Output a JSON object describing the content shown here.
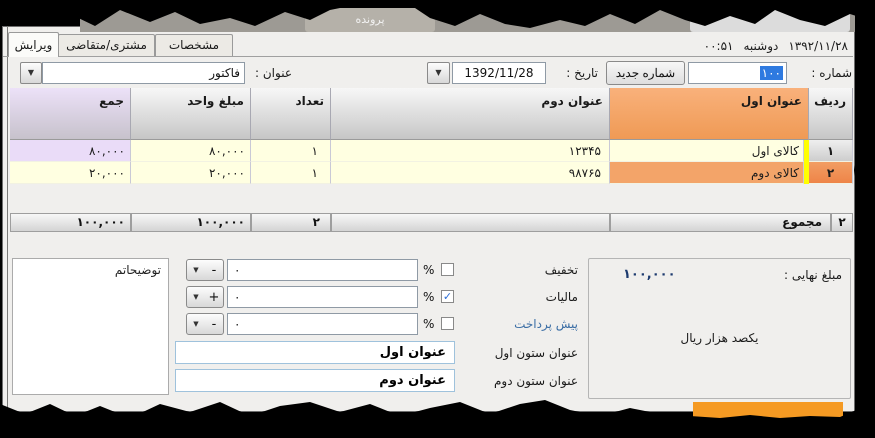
{
  "symbols": {
    "dropdown": "▼",
    "percent": "%"
  },
  "top_strip": {
    "file_tab": "پرونده"
  },
  "tabs": [
    {
      "label": "مشخصات"
    },
    {
      "label": "مشتری/متقاضی"
    },
    {
      "label": "ویرایش"
    }
  ],
  "timestamp": {
    "time": "۰۰:۵۱",
    "day": "دوشنبه",
    "date": "۱۳۹۲/۱۱/۲۸"
  },
  "fields": {
    "number_label": "شماره :",
    "number_value": "۱۰۰",
    "new_number_button": "شماره جدید",
    "date_label": "تاریخ :",
    "date_value": "1392/11/28",
    "title_label": "عنوان :",
    "title_value": "فاکتور"
  },
  "table": {
    "headers": {
      "row": "ردیف",
      "first_title": "عنوان اول",
      "second_title": "عنوان دوم",
      "count": "تعداد",
      "unit_price": "مبلغ واحد",
      "total": "جمع"
    },
    "rows": [
      {
        "row": "۱",
        "first_title": "کالای اول",
        "second_title": "۱۲۳۴۵",
        "count": "۱",
        "unit_price": "۸۰,۰۰۰",
        "total": "۸۰,۰۰۰"
      },
      {
        "row": "۲",
        "first_title": "کالای دوم",
        "second_title": "۹۸۷۶۵",
        "count": "۱",
        "unit_price": "۲۰,۰۰۰",
        "total": "۲۰,۰۰۰"
      }
    ],
    "summary": {
      "label": "مجموع",
      "row_count": "۲",
      "count": "۲",
      "unit_price": "۱۰۰,۰۰۰",
      "total": "۱۰۰,۰۰۰"
    }
  },
  "adjustments": {
    "rows": [
      {
        "label": "تخفیف",
        "check": "",
        "value": "۰",
        "sign": "-"
      },
      {
        "label": "مالیات",
        "check": "✓",
        "value": "۰",
        "sign": "+"
      },
      {
        "label": "پیش پرداخت",
        "check": "",
        "value": "۰",
        "sign": "-"
      }
    ],
    "column1_label": "عنوان ستون اول",
    "column1_value": "عنوان اول",
    "column2_label": "عنوان ستون دوم",
    "column2_value": "عنوان دوم"
  },
  "summary_box": {
    "final_label": "مبلغ نهایی :",
    "final_value": "۱۰۰,۰۰۰",
    "amount_in_words": "یکصد هزار ریال"
  },
  "notes": {
    "value": "توضیحاتم"
  },
  "colors": {
    "selected_row": "#f3a469",
    "header_orange": "#f2a05e",
    "row_yellow": "#ffffe1",
    "total_lavender": "#eadcf8",
    "marker_stripe": "#ffff00",
    "final_amount_text": "#1c3a6e",
    "prepayment_link": "#3b6ea5",
    "torn_accent_orange": "#f59a23"
  }
}
